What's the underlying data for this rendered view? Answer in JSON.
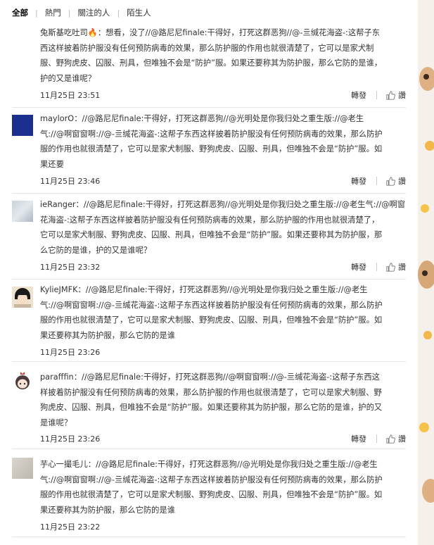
{
  "tabs": [
    {
      "label": "全部",
      "active": true
    },
    {
      "label": "熱門",
      "active": false
    },
    {
      "label": "關注的人",
      "active": false
    },
    {
      "label": "陌生人",
      "active": false
    }
  ],
  "actions": {
    "forward_label": "轉發",
    "like_label": "讚"
  },
  "colors": {
    "link": "#eb7350",
    "username_blue": "#1f5fa8",
    "text": "#333333",
    "divider": "#e6e6e6"
  },
  "comments": [
    {
      "author": "兔斯基吃吐司",
      "author_emoji": "candle-emoji",
      "lines": [
        "兔斯基吃吐司🔥：想看，没了//@路尼尼finale:干得好，打死这群恶狗//@-亖缄花海盗-:这帮子东",
        "西这样披着防护服没有任何预防病毒的效果，那么防护服的作用也就很清楚了，它可以是家犬制",
        "服、野狗虎皮、囚服、刑具，但唯独不会是“防护”服。如果还要称其为防护服，那么它防的是谁，",
        "护的又是谁呢？"
      ],
      "time": "11月25日 23:51"
    },
    {
      "author": "maylorO",
      "lines": [
        "maylorO：//@路尼尼finale:干得好，打死这群恶狗//@光明处是你我归处之重生版://@老生",
        "气://@啊窗窗啊://@-亖缄花海盗-:这帮子东西这样披着防护服没有任何预防病毒的效果，那么防护",
        "服的作用也就很清楚了，它可以是家犬制服、野狗虎皮、囚服、刑具，但唯独不会是“防护”服。如",
        "果还要"
      ],
      "time": "11月25日 23:46"
    },
    {
      "author": "ieRanger",
      "lines": [
        "ieRanger：//@路尼尼finale:干得好，打死这群恶狗//@光明处是你我归处之重生版://@老生气://@啊窗窗啊://@-亖缄",
        "花海盗-:这帮子东西这样披着防护服没有任何预防病毒的效果，那么防护服的作用也就很清楚了，",
        "它可以是家犬制服、野狗虎皮、囚服、刑具，但唯独不会是“防护”服。如果还要称其为防护服，那",
        "么它防的是谁，护的又是谁呢？"
      ],
      "time": "11月25日 23:32"
    },
    {
      "author": "KylieJMFK",
      "lines": [
        "KylieJMFK：//@路尼尼finale:干得好，打死这群恶狗//@光明处是你我归处之重生版://@老生",
        "气://@啊窗窗啊://@-亖缄花海盗-:这帮子东西这样披着防护服没有任何预防病毒的效果，那么防护",
        "服的作用也就很清楚了，它可以是家犬制服、野狗虎皮、囚服、刑具，但唯独不会是“防护”服。如",
        "果还要称其为防护服，那么它防的是谁"
      ],
      "time": "11月25日 23:26"
    },
    {
      "author": "parafffin",
      "lines": [
        "parafffin：//@路尼尼finale:干得好，打死这群恶狗//@啊窗窗啊://@-亖缄花海盗-:这帮子东西这",
        "样披着防护服没有任何预防病毒的效果，那么防护服的作用也就很清楚了，它可以是家犬制服、野",
        "狗虎皮、囚服、刑具，但唯独不会是“防护”服。如果还要称其为防护服，那么它防的是谁，护的又",
        "是谁呢？"
      ],
      "time": "11月25日 23:26"
    },
    {
      "author": "芋心一撮毛儿",
      "lines": [
        "芋心一撮毛儿：//@路尼尼finale:干得好，打死这群恶狗//@光明处是你我归处之重生版://@老生",
        "气://@啊窗窗啊://@-亖缄花海盗-:这帮子东西这样披着防护服没有任何预防病毒的效果，那么防护",
        "服的作用也就很清楚了，它可以是家犬制服、野狗虎皮、囚服、刑具，但唯独不会是“防护”服。如",
        "果还要称其为防护服，那么它防的是谁"
      ],
      "time": "11月25日 23:22"
    }
  ]
}
